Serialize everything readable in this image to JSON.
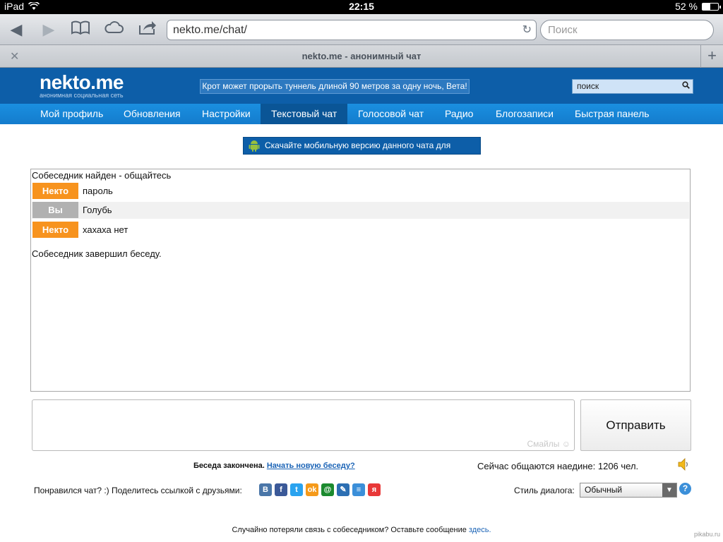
{
  "status_bar": {
    "device": "iPad",
    "time": "22:15",
    "battery": "52 %",
    "battery_level": 0.52
  },
  "browser": {
    "url": "nekto.me/chat/",
    "search_placeholder": "Поиск",
    "tab_title": "nekto.me - анонимный чат"
  },
  "site": {
    "logo": "nekto.me",
    "tagline": "анонимная социальная сеть",
    "announcement": "Крот может прорыть туннель длиной 90 метров за одну ночь, Вета!",
    "search_value": "поиск",
    "nav": [
      {
        "label": "Мой профиль",
        "active": false
      },
      {
        "label": "Обновления",
        "active": false
      },
      {
        "label": "Настройки",
        "active": false
      },
      {
        "label": "Текстовый чат",
        "active": true
      },
      {
        "label": "Голосовой чат",
        "active": false
      },
      {
        "label": "Радио",
        "active": false
      },
      {
        "label": "Блогозаписи",
        "active": false
      },
      {
        "label": "Быстрая панель",
        "active": false
      }
    ],
    "android_banner": "Скачайте мобильную версию данного чата для Android"
  },
  "chat": {
    "found_text": "Собеседник найден - общайтесь",
    "messages": [
      {
        "sender": "Некто",
        "role": "nekto",
        "text": "пароль"
      },
      {
        "sender": "Вы",
        "role": "you",
        "text": "Голубь"
      },
      {
        "sender": "Некто",
        "role": "nekto",
        "text": "хахаха нет"
      }
    ],
    "ended_text": "Собеседник завершил беседу.",
    "smiles_label": "Смайлы",
    "send_label": "Отправить"
  },
  "footer": {
    "conversation_ended": "Беседа закончена.",
    "new_conversation_link": "Начать новую беседу?",
    "online_count_text": "Сейчас общаются наедине: 1206 чел.",
    "share_text": "Понравился чат? :) Поделитесь ссылкой с друзьями:",
    "share_services": [
      {
        "name": "vk-icon",
        "glyph": "B",
        "color": "#4a76a8"
      },
      {
        "name": "facebook-icon",
        "glyph": "f",
        "color": "#3b5998"
      },
      {
        "name": "twitter-icon",
        "glyph": "t",
        "color": "#2aa3ef"
      },
      {
        "name": "odnoklassniki-icon",
        "glyph": "ok",
        "color": "#f59a1a"
      },
      {
        "name": "mailru-icon",
        "glyph": "@",
        "color": "#1b8a2e"
      },
      {
        "name": "livejournal-icon",
        "glyph": "✎",
        "color": "#2c6fb3"
      },
      {
        "name": "liveinternet-icon",
        "glyph": "≡",
        "color": "#3b8fd9"
      },
      {
        "name": "yaru-icon",
        "glyph": "я",
        "color": "#e83838"
      }
    ],
    "dialog_style_label": "Стиль диалога:",
    "dialog_style_value": "Обычный",
    "lost_text": "Случайно потеряли связь с собеседником? Оставьте сообщение",
    "lost_link": "здесь."
  },
  "watermark": "pikabu.ru",
  "colors": {
    "header": "#0d5ea8",
    "nav": "#1a8fe0",
    "nav_active": "#0a5596",
    "nekto_badge": "#f7931e",
    "you_badge": "#b1b1b1",
    "link": "#1a63b6"
  }
}
